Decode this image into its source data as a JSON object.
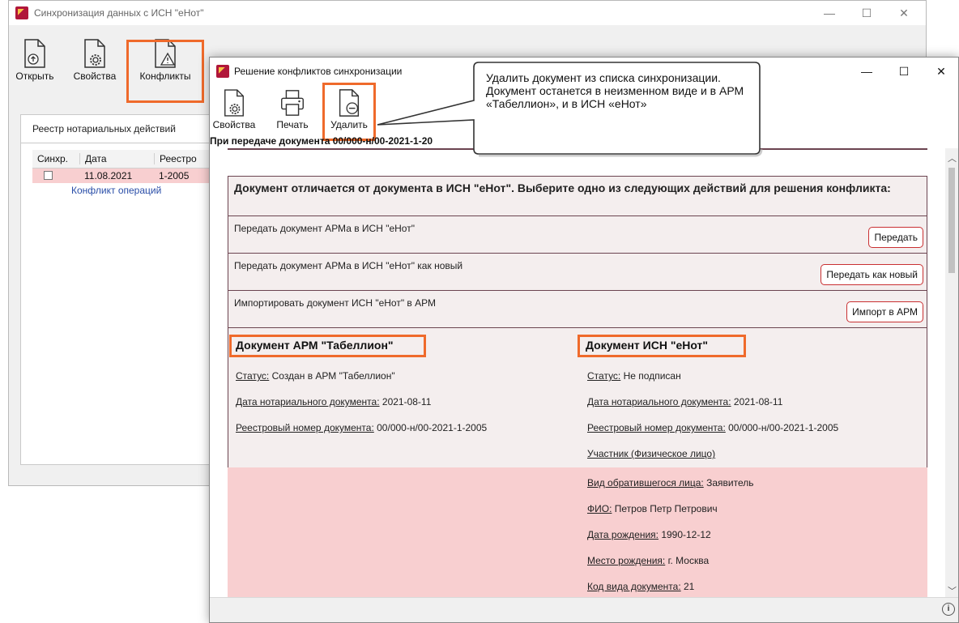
{
  "bg_window": {
    "title": "Синхронизация данных с ИСН \"еНот\"",
    "toolbar": [
      {
        "label": "Открыть",
        "icon": "open-doc-icon"
      },
      {
        "label": "Свойства",
        "icon": "properties-doc-icon"
      },
      {
        "label": "Конфликты",
        "icon": "conflict-doc-icon"
      }
    ],
    "tab_label": "Реестр нотариальных действий",
    "table": {
      "headers": [
        "Синхр.",
        "Дата",
        "Реестро"
      ],
      "row": {
        "date": "11.08.2021",
        "registry": "1-2005"
      },
      "conflict_link": "Конфликт операций"
    }
  },
  "dialog": {
    "title": "Решение конфликтов синхронизации",
    "toolbar": [
      {
        "label": "Свойства",
        "icon": "properties-doc-icon"
      },
      {
        "label": "Печать",
        "icon": "printer-icon"
      },
      {
        "label": "Удалить",
        "icon": "delete-doc-icon"
      }
    ],
    "callout": "Удалить документ из списка синхронизации. Документ останется в неизменном виде и в АРМ «Табеллион», и в ИСН «еНот»",
    "header_text": "При передаче документа 00/000-н/00-2021-1-20",
    "conflict_message": "Документ отличается от документа в ИСН \"еНот\". Выберите одно из следующих действий для решения конфликта:",
    "actions": [
      {
        "text": "Передать документ АРМа в ИСН \"еНот\"",
        "button": "Передать"
      },
      {
        "text": "Передать документ АРМа в ИСН \"еНот\" как новый",
        "button": "Передать как новый"
      },
      {
        "text": "Импортировать документ ИСН \"еНот\" в АРМ",
        "button": "Импорт в АРМ"
      }
    ],
    "left_doc": {
      "title": "Документ АРМ \"Табеллион\"",
      "fields": [
        {
          "label": "Статус:",
          "value": " Создан в АРМ \"Табеллион\""
        },
        {
          "label": "Дата нотариального документа:",
          "value": " 2021-08-11"
        },
        {
          "label": "Реестровый номер документа:",
          "value": " 00/000-н/00-2021-1-2005"
        }
      ]
    },
    "right_doc": {
      "title": "Документ ИСН \"еНот\"",
      "fields": [
        {
          "label": "Статус:",
          "value": " Не подписан"
        },
        {
          "label": "Дата нотариального документа:",
          "value": " 2021-08-11"
        },
        {
          "label": "Реестровый номер документа:",
          "value": " 00/000-н/00-2021-1-2005"
        }
      ],
      "participant": "Участник (Физическое лицо)",
      "participant_fields": [
        {
          "label": "Вид обратившегося лица:",
          "value": " Заявитель"
        },
        {
          "label": "ФИО:",
          "value": " Петров Петр Петрович"
        },
        {
          "label": "Дата рождения:",
          "value": " 1990-12-12"
        },
        {
          "label": "Место рождения:",
          "value": " г. Москва"
        },
        {
          "label": "Код вида документа:",
          "value": " 21"
        }
      ]
    }
  },
  "colors": {
    "accent": "#ef6a2b",
    "conflict_bg": "#f8cfd0",
    "panel_bg": "#f4eeee",
    "button_border": "#c93032"
  }
}
